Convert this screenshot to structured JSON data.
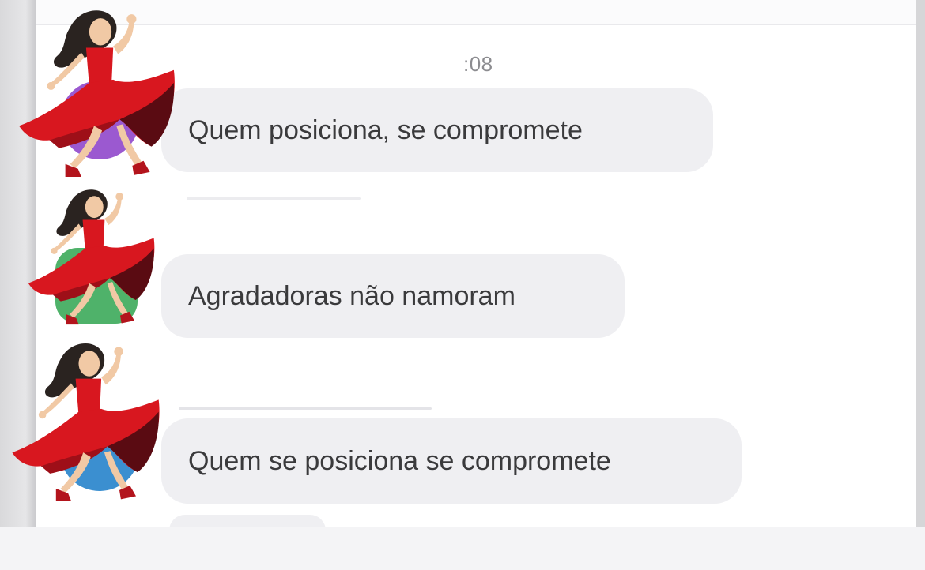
{
  "chat": {
    "timestamp": ":08",
    "messages": [
      {
        "text": "Quem posiciona, se compromete"
      },
      {
        "text": "Agradadoras não namoram"
      },
      {
        "text": "Quem se posiciona se compromete"
      },
      {
        "text": ""
      }
    ]
  },
  "icons": {
    "avatar_overlay": "woman-dancing-icon"
  },
  "colors": {
    "bubble": "#efeff2",
    "text": "#3a3a3c",
    "timestamp": "#8c8c90",
    "avatar_1": "#9b59d0",
    "avatar_2": "#4fb26a",
    "avatar_3": "#3b8fd0",
    "dress": "#d8171f"
  }
}
